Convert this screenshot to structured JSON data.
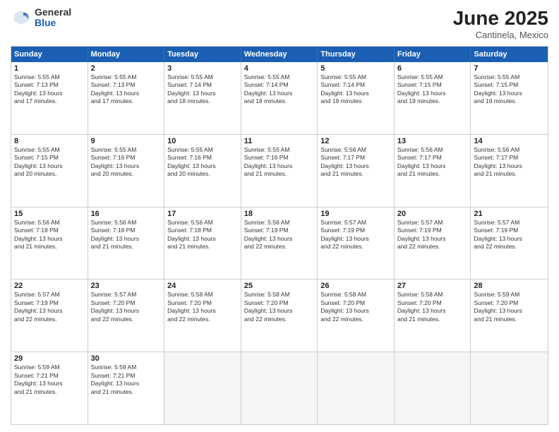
{
  "logo": {
    "general": "General",
    "blue": "Blue"
  },
  "title": {
    "month": "June 2025",
    "location": "Cantinela, Mexico"
  },
  "header": {
    "days": [
      "Sunday",
      "Monday",
      "Tuesday",
      "Wednesday",
      "Thursday",
      "Friday",
      "Saturday"
    ]
  },
  "rows": [
    [
      {
        "day": "1",
        "text": "Sunrise: 5:55 AM\nSunset: 7:13 PM\nDaylight: 13 hours\nand 17 minutes."
      },
      {
        "day": "2",
        "text": "Sunrise: 5:55 AM\nSunset: 7:13 PM\nDaylight: 13 hours\nand 17 minutes."
      },
      {
        "day": "3",
        "text": "Sunrise: 5:55 AM\nSunset: 7:14 PM\nDaylight: 13 hours\nand 18 minutes."
      },
      {
        "day": "4",
        "text": "Sunrise: 5:55 AM\nSunset: 7:14 PM\nDaylight: 13 hours\nand 18 minutes."
      },
      {
        "day": "5",
        "text": "Sunrise: 5:55 AM\nSunset: 7:14 PM\nDaylight: 13 hours\nand 19 minutes."
      },
      {
        "day": "6",
        "text": "Sunrise: 5:55 AM\nSunset: 7:15 PM\nDaylight: 13 hours\nand 19 minutes."
      },
      {
        "day": "7",
        "text": "Sunrise: 5:55 AM\nSunset: 7:15 PM\nDaylight: 13 hours\nand 19 minutes."
      }
    ],
    [
      {
        "day": "8",
        "text": "Sunrise: 5:55 AM\nSunset: 7:15 PM\nDaylight: 13 hours\nand 20 minutes."
      },
      {
        "day": "9",
        "text": "Sunrise: 5:55 AM\nSunset: 7:16 PM\nDaylight: 13 hours\nand 20 minutes."
      },
      {
        "day": "10",
        "text": "Sunrise: 5:55 AM\nSunset: 7:16 PM\nDaylight: 13 hours\nand 20 minutes."
      },
      {
        "day": "11",
        "text": "Sunrise: 5:55 AM\nSunset: 7:16 PM\nDaylight: 13 hours\nand 21 minutes."
      },
      {
        "day": "12",
        "text": "Sunrise: 5:56 AM\nSunset: 7:17 PM\nDaylight: 13 hours\nand 21 minutes."
      },
      {
        "day": "13",
        "text": "Sunrise: 5:56 AM\nSunset: 7:17 PM\nDaylight: 13 hours\nand 21 minutes."
      },
      {
        "day": "14",
        "text": "Sunrise: 5:56 AM\nSunset: 7:17 PM\nDaylight: 13 hours\nand 21 minutes."
      }
    ],
    [
      {
        "day": "15",
        "text": "Sunrise: 5:56 AM\nSunset: 7:18 PM\nDaylight: 13 hours\nand 21 minutes."
      },
      {
        "day": "16",
        "text": "Sunrise: 5:56 AM\nSunset: 7:18 PM\nDaylight: 13 hours\nand 21 minutes."
      },
      {
        "day": "17",
        "text": "Sunrise: 5:56 AM\nSunset: 7:18 PM\nDaylight: 13 hours\nand 21 minutes."
      },
      {
        "day": "18",
        "text": "Sunrise: 5:56 AM\nSunset: 7:19 PM\nDaylight: 13 hours\nand 22 minutes."
      },
      {
        "day": "19",
        "text": "Sunrise: 5:57 AM\nSunset: 7:19 PM\nDaylight: 13 hours\nand 22 minutes."
      },
      {
        "day": "20",
        "text": "Sunrise: 5:57 AM\nSunset: 7:19 PM\nDaylight: 13 hours\nand 22 minutes."
      },
      {
        "day": "21",
        "text": "Sunrise: 5:57 AM\nSunset: 7:19 PM\nDaylight: 13 hours\nand 22 minutes."
      }
    ],
    [
      {
        "day": "22",
        "text": "Sunrise: 5:57 AM\nSunset: 7:19 PM\nDaylight: 13 hours\nand 22 minutes."
      },
      {
        "day": "23",
        "text": "Sunrise: 5:57 AM\nSunset: 7:20 PM\nDaylight: 13 hours\nand 22 minutes."
      },
      {
        "day": "24",
        "text": "Sunrise: 5:58 AM\nSunset: 7:20 PM\nDaylight: 13 hours\nand 22 minutes."
      },
      {
        "day": "25",
        "text": "Sunrise: 5:58 AM\nSunset: 7:20 PM\nDaylight: 13 hours\nand 22 minutes."
      },
      {
        "day": "26",
        "text": "Sunrise: 5:58 AM\nSunset: 7:20 PM\nDaylight: 13 hours\nand 22 minutes."
      },
      {
        "day": "27",
        "text": "Sunrise: 5:58 AM\nSunset: 7:20 PM\nDaylight: 13 hours\nand 21 minutes."
      },
      {
        "day": "28",
        "text": "Sunrise: 5:59 AM\nSunset: 7:20 PM\nDaylight: 13 hours\nand 21 minutes."
      }
    ],
    [
      {
        "day": "29",
        "text": "Sunrise: 5:59 AM\nSunset: 7:21 PM\nDaylight: 13 hours\nand 21 minutes."
      },
      {
        "day": "30",
        "text": "Sunrise: 5:59 AM\nSunset: 7:21 PM\nDaylight: 13 hours\nand 21 minutes."
      },
      {
        "day": "",
        "text": ""
      },
      {
        "day": "",
        "text": ""
      },
      {
        "day": "",
        "text": ""
      },
      {
        "day": "",
        "text": ""
      },
      {
        "day": "",
        "text": ""
      }
    ]
  ]
}
